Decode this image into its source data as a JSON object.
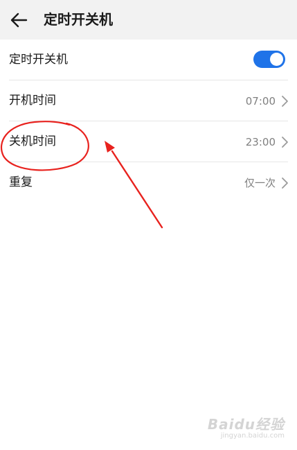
{
  "header": {
    "title": "定时开关机",
    "back_icon": "arrow-left-icon"
  },
  "rows": [
    {
      "label": "定时开关机",
      "type": "toggle",
      "toggle_on": true
    },
    {
      "label": "开机时间",
      "value": "07:00",
      "type": "nav"
    },
    {
      "label": "关机时间",
      "value": "23:00",
      "type": "nav"
    },
    {
      "label": "重复",
      "value": "仅一次",
      "type": "nav"
    }
  ],
  "colors": {
    "accent": "#1f73e8",
    "annotation": "#e8221e"
  },
  "watermark": {
    "brand": "Baidu经验",
    "url": "jingyan.baidu.com"
  }
}
